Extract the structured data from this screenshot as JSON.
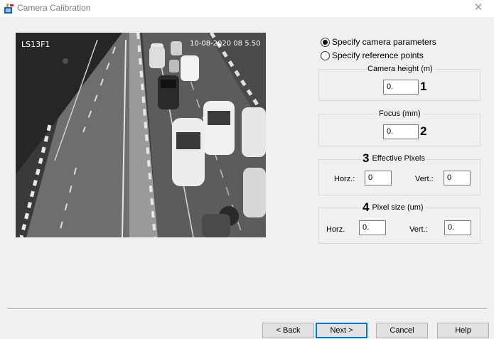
{
  "window": {
    "title": "Camera Calibration",
    "close_glyph": "✕",
    "app_icon": "camera-calibration-app-icon"
  },
  "camera_view": {
    "overlay_id": "LS13F1",
    "overlay_timestamp": "10-08-2020 08 5.50"
  },
  "mode": {
    "options": [
      {
        "label": "Specify camera parameters",
        "selected": true
      },
      {
        "label": "Specify reference points",
        "selected": false
      }
    ]
  },
  "camera_height": {
    "legend": "Camera height (m)",
    "value": "0.",
    "marker": "1"
  },
  "focus": {
    "legend": "Focus (mm)",
    "value": "0.",
    "marker": "2"
  },
  "effective_pixels": {
    "legend": "Effective Pixels",
    "marker": "3",
    "horz_label": "Horz.:",
    "horz_value": "0",
    "vert_label": "Vert.:",
    "vert_value": "0"
  },
  "pixel_size": {
    "legend": "Pixel size (um)",
    "marker": "4",
    "horz_label": "Horz.",
    "horz_value": "0.",
    "vert_label": "Vert.:",
    "vert_value": "0."
  },
  "buttons": {
    "back": "< Back",
    "next": "Next >",
    "cancel": "Cancel",
    "help": "Help"
  },
  "colors": {
    "accent": "#0078d7",
    "window_bg": "#f0f0f0"
  }
}
